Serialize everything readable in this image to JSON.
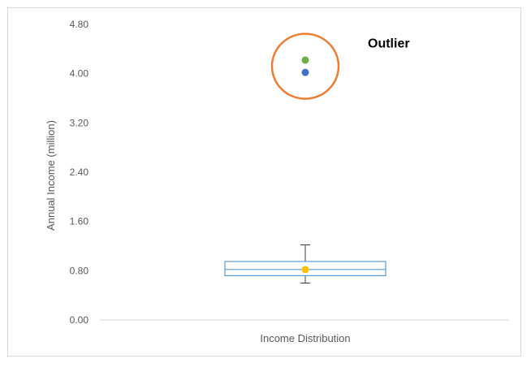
{
  "chart_data": {
    "type": "box",
    "title": "",
    "xlabel": "Income Distribution",
    "ylabel": "Annual Income (million)",
    "ylim": [
      0,
      4.8
    ],
    "yticks": [
      "0.00",
      "0.80",
      "1.60",
      "2.40",
      "3.20",
      "4.00",
      "4.80"
    ],
    "grid": false,
    "categories": [
      "Income Distribution"
    ],
    "box": {
      "whisker_low": 0.6,
      "q1": 0.72,
      "median": 0.82,
      "q3": 0.95,
      "whisker_high": 1.22,
      "mean": 0.82
    },
    "outliers": [
      {
        "value": 4.02,
        "color": "#4472c4"
      },
      {
        "value": 4.22,
        "color": "#70ad47"
      }
    ],
    "annotation": {
      "text": "Outlier",
      "circle_color": "#ed7d31"
    },
    "colors": {
      "box_border": "#5b9bd5",
      "mean_marker": "#ffc000",
      "whisker": "#404040",
      "axis_line": "#d9d9d9"
    }
  }
}
